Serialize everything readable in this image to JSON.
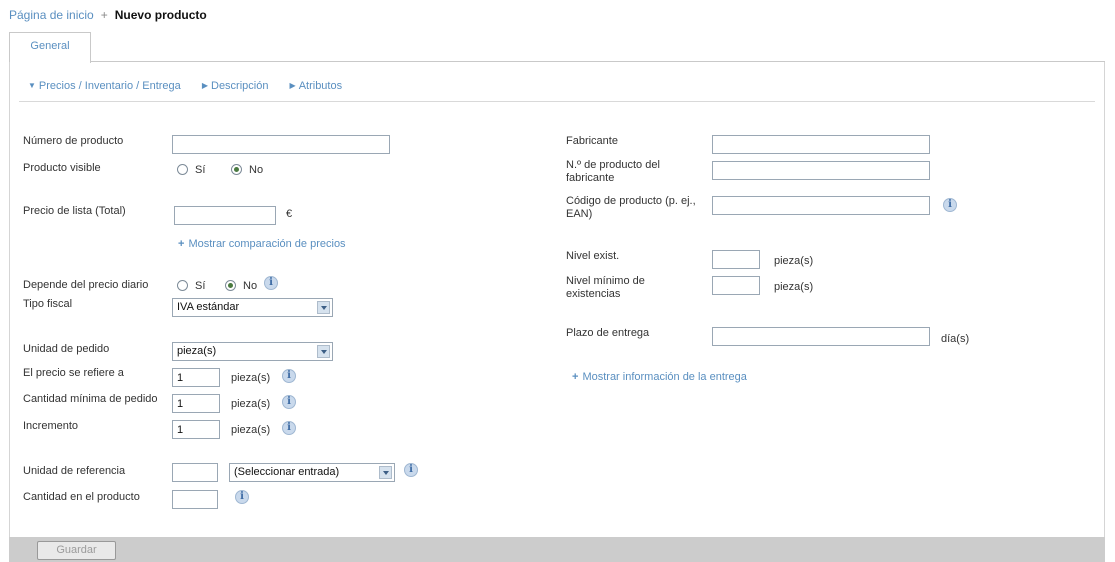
{
  "breadcrumb": {
    "home": "Página de inicio",
    "separator": "+",
    "current": "Nuevo producto"
  },
  "tabs": [
    {
      "label": "General"
    }
  ],
  "subnav": [
    {
      "label": "Precios / Inventario / Entrega"
    },
    {
      "label": "Descripción"
    },
    {
      "label": "Atributos"
    }
  ],
  "left": {
    "product_number": {
      "label": "Número de producto",
      "value": ""
    },
    "visible": {
      "label": "Producto visible",
      "yes": "Sí",
      "no": "No",
      "selected": "No"
    },
    "list_price": {
      "label": "Precio de lista (Total)",
      "value": "",
      "unit": "€"
    },
    "show_price_comparison": "Mostrar comparación de precios",
    "daily_price": {
      "label": "Depende del precio diario",
      "yes": "Sí",
      "no": "No",
      "selected": "No"
    },
    "tax_type": {
      "label": "Tipo fiscal",
      "value": "IVA estándar"
    },
    "order_unit": {
      "label": "Unidad de pedido",
      "value": "pieza(s)"
    },
    "price_refers": {
      "label": "El precio se refiere a",
      "value": "1",
      "unit": "pieza(s)"
    },
    "min_order": {
      "label": "Cantidad mínima de pedido",
      "value": "1",
      "unit": "pieza(s)"
    },
    "increment": {
      "label": "Incremento",
      "value": "1",
      "unit": "pieza(s)"
    },
    "ref_unit": {
      "label": "Unidad de referencia",
      "value": "",
      "select": "(Seleccionar entrada)"
    },
    "qty_in_product": {
      "label": "Cantidad en el producto",
      "value": ""
    }
  },
  "right": {
    "manufacturer": {
      "label": "Fabricante",
      "value": ""
    },
    "mfr_product_no": {
      "label": "N.º de producto del fabricante",
      "value": ""
    },
    "product_code": {
      "label": "Código de producto (p. ej., EAN)",
      "value": ""
    },
    "stock_level": {
      "label": "Nivel exist.",
      "value": "",
      "unit": "pieza(s)"
    },
    "min_stock": {
      "label": "Nivel mínimo de existencias",
      "value": "",
      "unit": "pieza(s)"
    },
    "delivery_time": {
      "label": "Plazo de entrega",
      "value": "",
      "unit": "día(s)"
    },
    "show_delivery_info": "Mostrar información de la entrega"
  },
  "icons": {
    "info": "info-icon",
    "plus": "plus-icon",
    "dropdown": "chevron-down-icon"
  },
  "colors": {
    "link": "#5a8fc0",
    "footer": "#cccccc",
    "radio_selected": "#4a7a40"
  },
  "footer": {
    "save": "Guardar"
  }
}
